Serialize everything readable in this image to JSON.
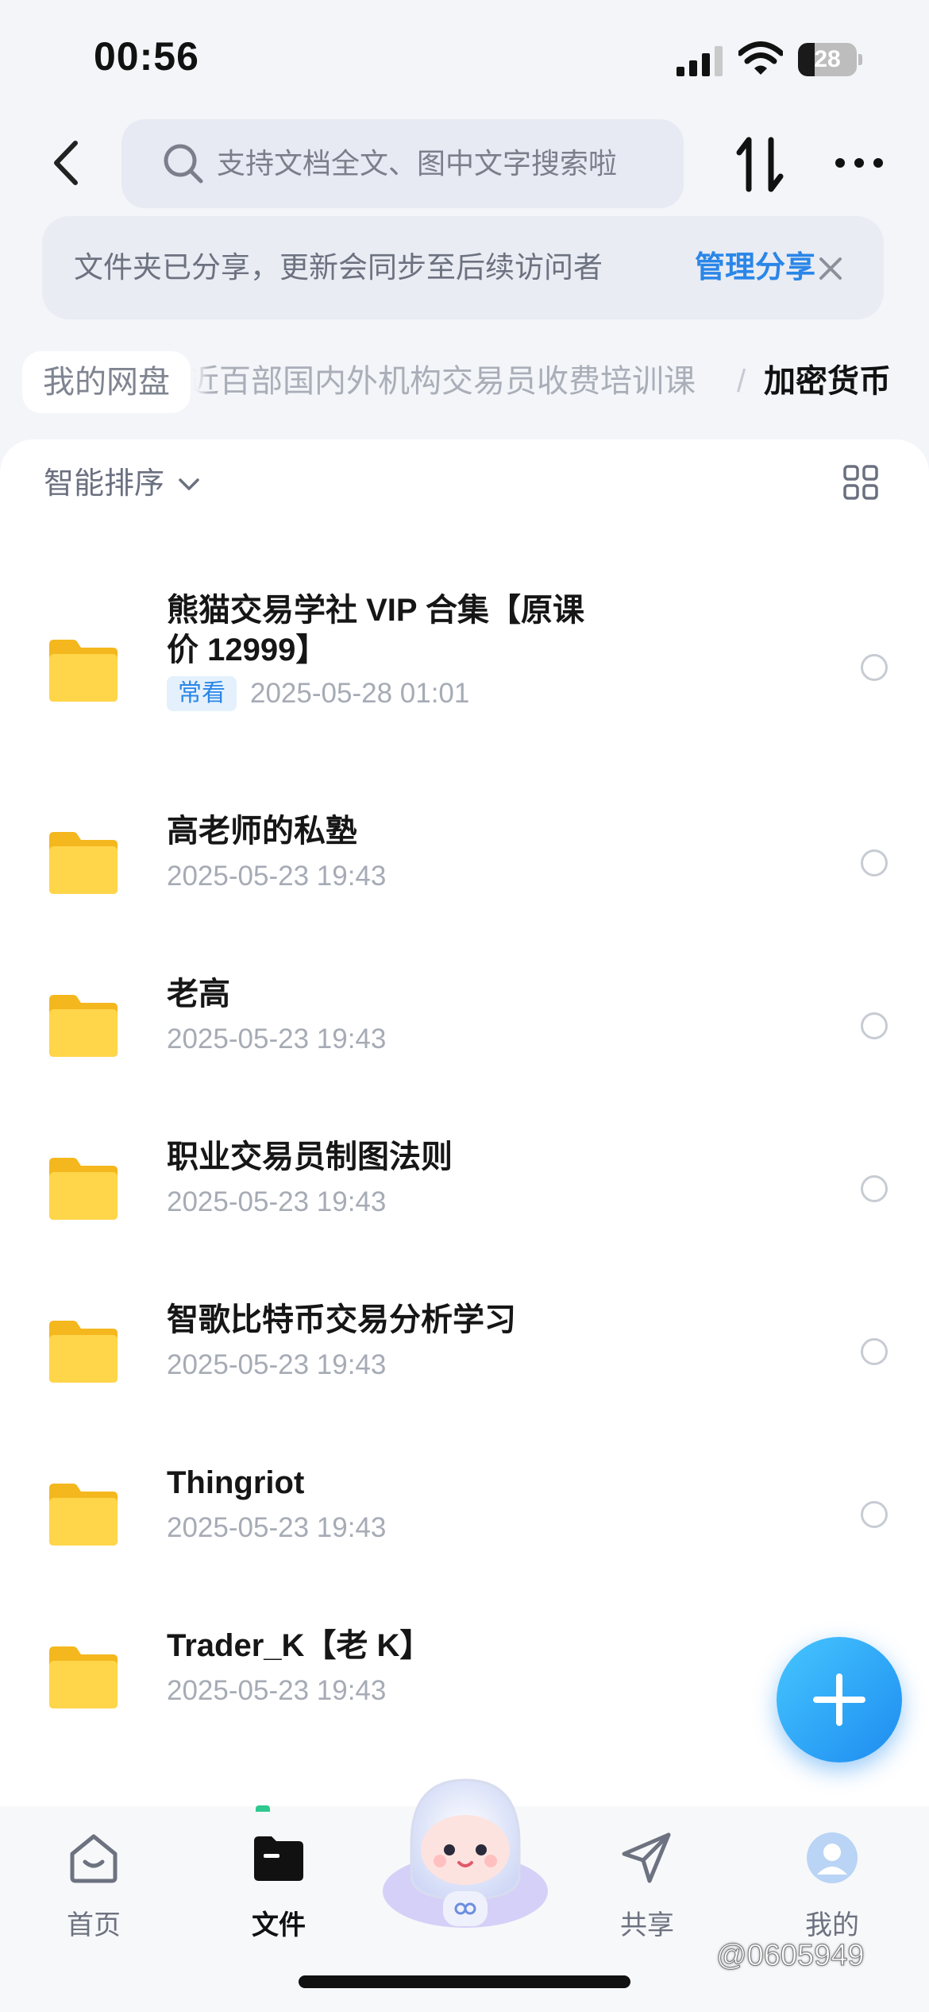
{
  "status_bar": {
    "time": "00:56",
    "battery": "28",
    "battery_level": 0.28
  },
  "header": {
    "search_placeholder": "支持文档全文、图中文字搜索啦"
  },
  "notice": {
    "text": "文件夹已分享，更新会同步至后续访问者",
    "link": "管理分享"
  },
  "breadcrumb": {
    "root": "我的网盘",
    "middle": "近百部国内外机构交易员收费培训课",
    "separator": "/",
    "current": "加密货币"
  },
  "toolbar": {
    "sort_label": "智能排序"
  },
  "files": [
    {
      "name_line1": "熊猫交易学社 VIP 合集【原课",
      "name_line2": "价 12999】",
      "badge": "常看",
      "date": "2025-05-28 01:01"
    },
    {
      "name": "高老师的私塾",
      "date": "2025-05-23 19:43"
    },
    {
      "name": "老高",
      "date": "2025-05-23 19:43"
    },
    {
      "name": "职业交易员制图法则",
      "date": "2025-05-23 19:43"
    },
    {
      "name": "智歌比特币交易分析学习",
      "date": "2025-05-23 19:43"
    },
    {
      "name": "Thingriot",
      "date": "2025-05-23 19:43"
    },
    {
      "name": "Trader_K【老 K】",
      "date": "2025-05-23 19:43"
    }
  ],
  "tabs": [
    {
      "label": "首页",
      "icon": "home-icon"
    },
    {
      "label": "文件",
      "icon": "folder-icon"
    },
    {
      "label": "共享",
      "icon": "send-icon"
    },
    {
      "label": "我的",
      "icon": "profile-icon"
    }
  ],
  "watermark": "@0605949",
  "colors": {
    "accent": "#2a86e8",
    "folder": "#ffcd3c",
    "fab": "#1d8cf0"
  }
}
